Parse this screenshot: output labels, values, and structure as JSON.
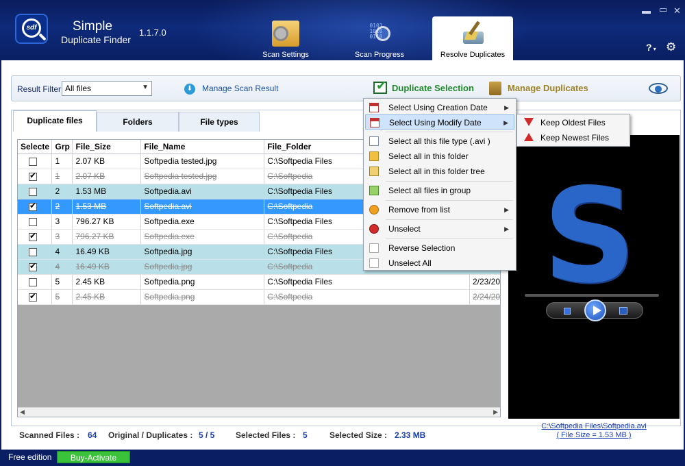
{
  "app": {
    "name_line1": "Simple",
    "name_line2": "Duplicate Finder",
    "version": "1.1.7.0"
  },
  "header_tabs": [
    {
      "label": "Scan Settings",
      "icon": "settings-folder-icon"
    },
    {
      "label": "Scan Progress",
      "icon": "scan-magnifier-icon"
    },
    {
      "label": "Resolve Duplicates",
      "icon": "broom-icon",
      "active": true
    }
  ],
  "window": {
    "help": "?",
    "minimize": "▬",
    "close": "✕"
  },
  "toolbar": {
    "filter_label": "Result Filter",
    "filter_value": "All files",
    "manage_scan": "Manage Scan Result",
    "dup_selection": "Duplicate Selection",
    "manage_dups": "Manage Duplicates"
  },
  "tabs": [
    "Duplicate files",
    "Folders",
    "File types"
  ],
  "columns": [
    "Selecte",
    "Grp",
    "File_Size",
    "File_Name",
    "File_Folder"
  ],
  "rows": [
    {
      "checked": false,
      "grp": "1",
      "size": "2.07 KB",
      "name": "Softpedia tested.jpg",
      "folder": "C:\\Softpedia Files",
      "date": ""
    },
    {
      "checked": true,
      "grp": "1",
      "size": "2.07 KB",
      "name": "Softpedia tested.jpg",
      "folder": "C:\\Softpedia",
      "date": ""
    },
    {
      "checked": false,
      "grp": "2",
      "size": "1.53 MB",
      "name": "Softpedia.avi",
      "folder": "C:\\Softpedia Files",
      "date": ""
    },
    {
      "checked": true,
      "grp": "2",
      "size": "1.53 MB",
      "name": "Softpedia.avi",
      "folder": "C:\\Softpedia",
      "date": ""
    },
    {
      "checked": false,
      "grp": "3",
      "size": "796.27 KB",
      "name": "Softpedia.exe",
      "folder": "C:\\Softpedia Files",
      "date": ""
    },
    {
      "checked": true,
      "grp": "3",
      "size": "796.27 KB",
      "name": "Softpedia.exe",
      "folder": "C:\\Softpedia",
      "date": ""
    },
    {
      "checked": false,
      "grp": "4",
      "size": "16.49 KB",
      "name": "Softpedia.jpg",
      "folder": "C:\\Softpedia Files",
      "date": ""
    },
    {
      "checked": true,
      "grp": "4",
      "size": "16.49 KB",
      "name": "Softpedia.jpg",
      "folder": "C:\\Softpedia",
      "date": ""
    },
    {
      "checked": false,
      "grp": "5",
      "size": "2.45 KB",
      "name": "Softpedia.png",
      "folder": "C:\\Softpedia Files",
      "date": "2/23/20"
    },
    {
      "checked": true,
      "grp": "5",
      "size": "2.45 KB",
      "name": "Softpedia.png",
      "folder": "C:\\Softpedia",
      "date": "2/24/20"
    }
  ],
  "menu": {
    "items": [
      {
        "label": "Select Using Creation Date",
        "sub": "▶"
      },
      {
        "label": "Select Using Modify Date",
        "sub": "▶"
      },
      {
        "label": "Select all this file type (.avi )"
      },
      {
        "label": "Select all in this folder"
      },
      {
        "label": "Select all in this folder tree"
      },
      {
        "label": "Select all files in group"
      },
      {
        "label": "Remove from list",
        "sub": "▶"
      },
      {
        "label": "Unselect",
        "sub": "▶"
      },
      {
        "label": "Reverse Selection"
      },
      {
        "label": "Unselect All"
      }
    ],
    "submenu": [
      "Keep Oldest Files",
      "Keep Newest Files"
    ]
  },
  "preview": {
    "path": "C:\\Softpedia Files\\Softpedia.avi",
    "size": "( File Size =  1.53 MB  )"
  },
  "stats": {
    "scanned_label": "Scanned Files :",
    "scanned": "64",
    "orig_label": "Original / Duplicates :",
    "orig": "5 / 5",
    "sel_label": "Selected Files :",
    "sel": "5",
    "size_label": "Selected Size :",
    "size": "2.33 MB"
  },
  "footer": {
    "edition": "Free edition",
    "buy": "Buy-Activate"
  }
}
